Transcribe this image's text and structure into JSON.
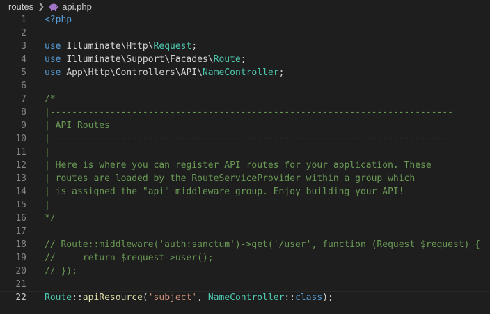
{
  "breadcrumb": {
    "folder": "routes",
    "file": "api.php",
    "file_icon": "php-elephant-icon"
  },
  "colors": {
    "background": "#1e1e1e",
    "keyword": "#569cd6",
    "class": "#4ec9b0",
    "comment": "#6a9955",
    "string": "#ce9178",
    "function": "#dcdcaa",
    "text": "#d4d4d4",
    "line_number": "#858585",
    "php_icon": "#a074c4"
  },
  "editor": {
    "current_line": 22,
    "lines": [
      {
        "num": "1",
        "tokens": [
          {
            "t": "<?php",
            "c": "kw"
          }
        ]
      },
      {
        "num": "2",
        "tokens": []
      },
      {
        "num": "3",
        "tokens": [
          {
            "t": "use ",
            "c": "kw"
          },
          {
            "t": "Illuminate\\Http\\",
            "c": "plain"
          },
          {
            "t": "Request",
            "c": "cls"
          },
          {
            "t": ";",
            "c": "plain"
          }
        ]
      },
      {
        "num": "4",
        "tokens": [
          {
            "t": "use ",
            "c": "kw"
          },
          {
            "t": "Illuminate\\Support\\Facades\\",
            "c": "plain"
          },
          {
            "t": "Route",
            "c": "cls"
          },
          {
            "t": ";",
            "c": "plain"
          }
        ]
      },
      {
        "num": "5",
        "tokens": [
          {
            "t": "use ",
            "c": "kw"
          },
          {
            "t": "App\\Http\\Controllers\\API\\",
            "c": "plain"
          },
          {
            "t": "NameController",
            "c": "cls"
          },
          {
            "t": ";",
            "c": "plain"
          }
        ]
      },
      {
        "num": "6",
        "tokens": []
      },
      {
        "num": "7",
        "tokens": [
          {
            "t": "/*",
            "c": "cmt"
          }
        ]
      },
      {
        "num": "8",
        "tokens": [
          {
            "t": "|--------------------------------------------------------------------------",
            "c": "cmt"
          }
        ]
      },
      {
        "num": "9",
        "tokens": [
          {
            "t": "| API Routes",
            "c": "cmt"
          }
        ]
      },
      {
        "num": "10",
        "tokens": [
          {
            "t": "|--------------------------------------------------------------------------",
            "c": "cmt"
          }
        ]
      },
      {
        "num": "11",
        "tokens": [
          {
            "t": "|",
            "c": "cmt"
          }
        ]
      },
      {
        "num": "12",
        "tokens": [
          {
            "t": "| Here is where you can register API routes for your application. These",
            "c": "cmt"
          }
        ]
      },
      {
        "num": "13",
        "tokens": [
          {
            "t": "| routes are loaded by the RouteServiceProvider within a group which",
            "c": "cmt"
          }
        ]
      },
      {
        "num": "14",
        "tokens": [
          {
            "t": "| is assigned the \"api\" middleware group. Enjoy building your API!",
            "c": "cmt"
          }
        ]
      },
      {
        "num": "15",
        "tokens": [
          {
            "t": "|",
            "c": "cmt"
          }
        ]
      },
      {
        "num": "16",
        "tokens": [
          {
            "t": "*/",
            "c": "cmt"
          }
        ]
      },
      {
        "num": "17",
        "tokens": []
      },
      {
        "num": "18",
        "tokens": [
          {
            "t": "// Route::middleware('auth:sanctum')->get('/user', function (Request $request) {",
            "c": "cmt"
          }
        ]
      },
      {
        "num": "19",
        "tokens": [
          {
            "t": "//     return $request->user();",
            "c": "cmt"
          }
        ]
      },
      {
        "num": "20",
        "tokens": [
          {
            "t": "// });",
            "c": "cmt"
          }
        ]
      },
      {
        "num": "21",
        "tokens": []
      },
      {
        "num": "22",
        "tokens": [
          {
            "t": "Route",
            "c": "cls"
          },
          {
            "t": "::",
            "c": "plain"
          },
          {
            "t": "apiResource",
            "c": "fn"
          },
          {
            "t": "(",
            "c": "plain"
          },
          {
            "t": "'subject'",
            "c": "str"
          },
          {
            "t": ", ",
            "c": "plain"
          },
          {
            "t": "NameController",
            "c": "cls"
          },
          {
            "t": "::",
            "c": "plain"
          },
          {
            "t": "class",
            "c": "kw"
          },
          {
            "t": ");",
            "c": "plain"
          }
        ]
      }
    ]
  }
}
